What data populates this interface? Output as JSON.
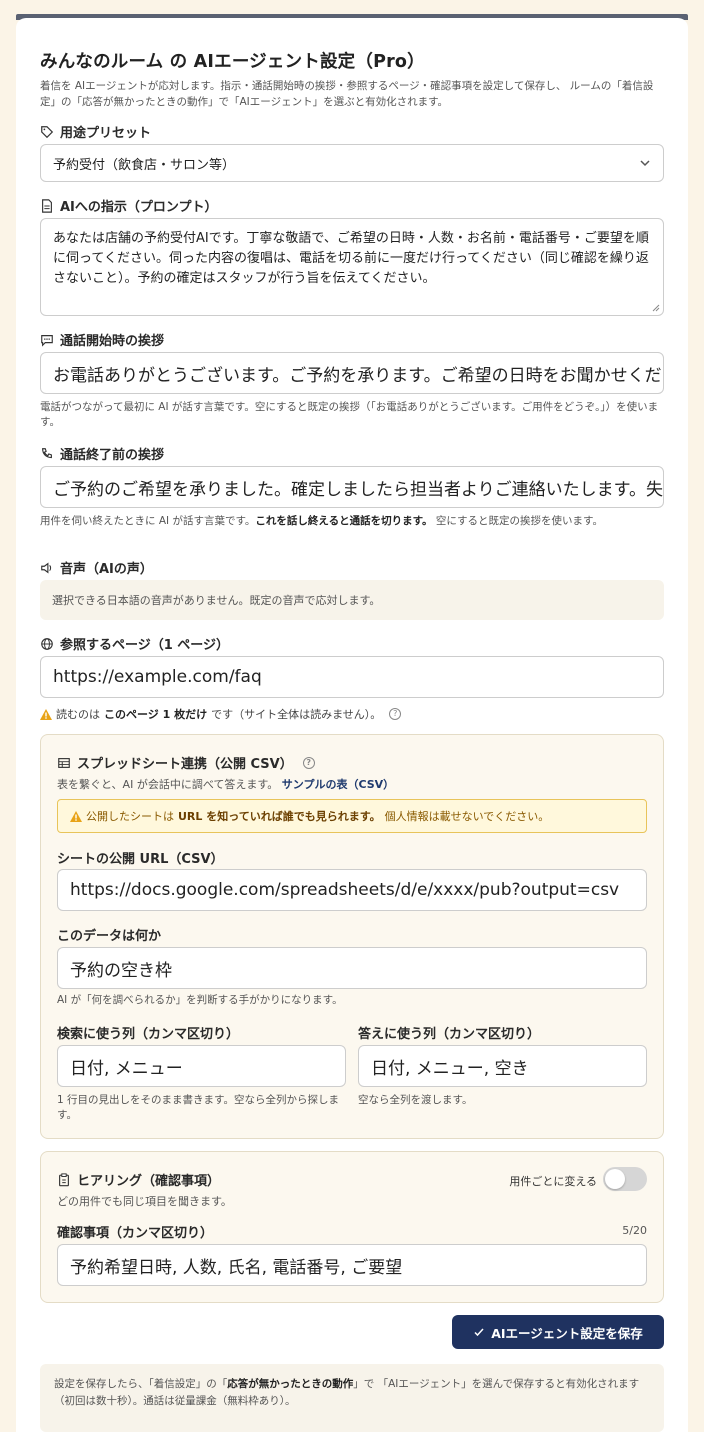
{
  "header": {
    "title": "みんなのルーム の AIエージェント設定（Pro）",
    "description": "着信を AIエージェントが応対します。指示・通話開始時の挨拶・参照するページ・確認事項を設定して保存し、 ルームの「着信設定」の「応答が無かったときの動作」で「AIエージェント」を選ぶと有効化されます。"
  },
  "preset": {
    "label": "用途プリセット",
    "selected": "予約受付（飲食店・サロン等）"
  },
  "prompt": {
    "label": "AIへの指示（プロンプト）",
    "value": "あなたは店舗の予約受付AIです。丁寧な敬語で、ご希望の日時・人数・お名前・電話番号・ご要望を順に伺ってください。伺った内容の復唱は、電話を切る前に一度だけ行ってください（同じ確認を繰り返さないこと）。予約の確定はスタッフが行う旨を伝えてください。"
  },
  "greeting": {
    "label": "通話開始時の挨拶",
    "value": "お電話ありがとうございます。ご予約を承ります。ご希望の日時をお聞かせください",
    "help": "電話がつながって最初に AI が話す言葉です。空にすると既定の挨拶（「お電話ありがとうございます。ご用件をどうぞ。」）を使います。"
  },
  "closing": {
    "label": "通話終了前の挨拶",
    "value": "ご予約のご希望を承りました。確定しましたら担当者よりご連絡いたします。失礼いたします。",
    "help_pre": "用件を伺い終えたときに AI が話す言葉です。",
    "help_bold": "これを話し終えると通話を切ります。",
    "help_post": " 空にすると既定の挨拶を使います。"
  },
  "voice": {
    "label": "音声（AIの声）",
    "notice": "選択できる日本語の音声がありません。既定の音声で応対します。"
  },
  "reference": {
    "label": "参照するページ（1 ページ）",
    "value": "https://example.com/faq",
    "note_pre": "読むのは",
    "note_bold": "このページ 1 枚だけ",
    "note_post": "です（サイト全体は読みません）。"
  },
  "spreadsheet": {
    "title": "スプレッドシート連携（公開 CSV）",
    "subtitle": "表を繋ぐと、AI が会話中に調べて答えます。",
    "sample_link": "サンプルの表（CSV）",
    "warning_pre": "公開したシートは",
    "warning_bold": "URL を知っていれば誰でも見られます。",
    "warning_post": "個人情報は載せないでください。",
    "url_label": "シートの公開 URL（CSV）",
    "url_value": "https://docs.google.com/spreadsheets/d/e/xxxx/pub?output=csv",
    "what_label": "このデータは何か",
    "what_value": "予約の空き枠",
    "what_help": "AI が「何を調べられるか」を判断する手がかりになります。",
    "search_label": "検索に使う列（カンマ区切り）",
    "search_value": "日付, メニュー",
    "search_help": "1 行目の見出しをそのまま書きます。空なら全列から探します。",
    "answer_label": "答えに使う列（カンマ区切り）",
    "answer_value": "日付, メニュー, 空き",
    "answer_help": "空なら全列を渡します。"
  },
  "hearing": {
    "title": "ヒアリング（確認事項）",
    "subtitle": "どの用件でも同じ項目を聞きます。",
    "toggle_label": "用件ごとに変える",
    "toggle_on": false,
    "items_label": "確認事項（カンマ区切り）",
    "count": "5/20",
    "items_value": "予約希望日時, 人数, 氏名, 電話番号, ご要望"
  },
  "save_button": "AIエージェント設定を保存",
  "footer": {
    "pre": "設定を保存したら、「着信設定」の「",
    "bold": "応答が無かったときの動作",
    "post": "」で 「AIエージェント」を選んで保存すると有効化されます（初回は数十秒）。通話は従量課金（無料枠あり）。"
  },
  "colors": {
    "accent": "#1f3260",
    "background": "#fbf4e7",
    "warning": "#e8a317"
  }
}
